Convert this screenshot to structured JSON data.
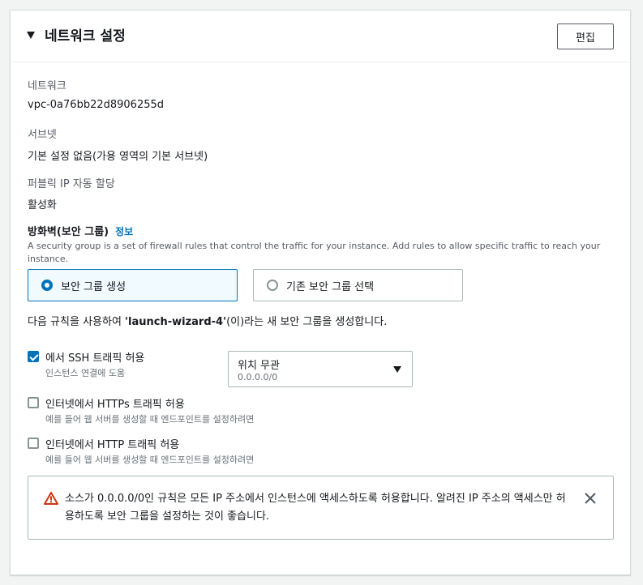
{
  "panel": {
    "title": "네트워크 설정",
    "edit_label": "편집"
  },
  "fields": {
    "network_label": "네트워크",
    "network_value": "vpc-0a76bb22d8906255d",
    "subnet_label": "서브넷",
    "subnet_value": "기본 설정 없음(가용 영역의 기본 서브넷)",
    "public_ip_label": "퍼블릭 IP 자동 할당",
    "public_ip_value": "활성화"
  },
  "firewall": {
    "title": "방화벽(보안 그룹)",
    "info_link": "정보",
    "description": "A security group is a set of firewall rules that control the traffic for your instance. Add rules to allow specific traffic to reach your instance.",
    "options": [
      {
        "label": "보안 그룹 생성",
        "selected": true
      },
      {
        "label": "기존 보안 그룹 선택",
        "selected": false
      }
    ],
    "rules_prefix": "다음 규칙을 사용하여 ",
    "rules_group_name": "'launch-wizard-4'",
    "rules_suffix": "(이)라는 새 보안 그룹을 생성합니다."
  },
  "rules": [
    {
      "label": "에서 SSH 트래픽 허용",
      "description": "인스턴스 연결에 도움",
      "checked": true
    },
    {
      "label": "인터넷에서 HTTPs 트래픽 허용",
      "description": "예를 들어 웹 서버를 생성할 때 엔드포인트를 설정하려면",
      "checked": false
    },
    {
      "label": "인터넷에서 HTTP 트래픽 허용",
      "description": "예를 들어 웹 서버를 생성할 때 엔드포인트를 설정하려면",
      "checked": false
    }
  ],
  "ssh_source": {
    "value": "위치 무관",
    "sub": "0.0.0.0/0"
  },
  "alert": {
    "text": "소스가 0.0.0.0/0인 규칙은 모든 IP 주소에서 인스턴스에 액세스하도록 허용합니다. 알려진 IP 주소의 액세스만 허용하도록 보안 그룹을 설정하는 것이 좋습니다."
  },
  "colors": {
    "accent": "#0073bb",
    "warning": "#d13212",
    "background": "#f2f3f3"
  },
  "icons": {
    "collapse": "caret-down-icon",
    "select": "dropdown-caret-icon",
    "warning": "warning-icon",
    "dismiss": "close-icon"
  }
}
